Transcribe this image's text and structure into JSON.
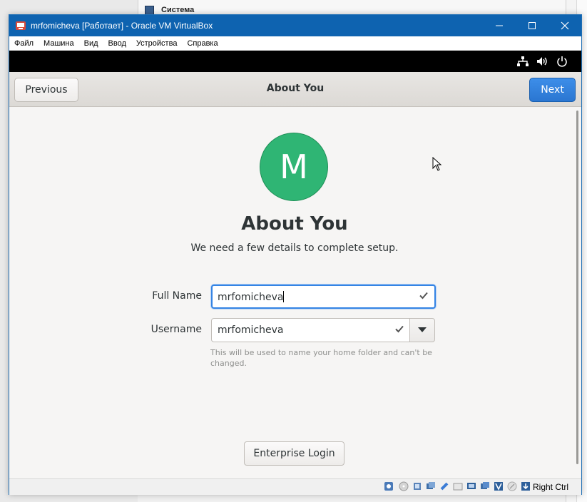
{
  "background": {
    "panel_title": "Система"
  },
  "window": {
    "title": "mrfomicheva [Работает] - Oracle VM VirtualBox",
    "menu": [
      "Файл",
      "Машина",
      "Вид",
      "Ввод",
      "Устройства",
      "Справка"
    ],
    "toolbar_icons": [
      "network-icon",
      "speaker-icon",
      "power-icon"
    ]
  },
  "header": {
    "previous_label": "Previous",
    "title": "About You",
    "next_label": "Next"
  },
  "content": {
    "avatar_letter": "M",
    "heading": "About You",
    "subtitle": "We need a few details to complete setup.",
    "full_name": {
      "label": "Full Name",
      "value": "mrfomicheva"
    },
    "username": {
      "label": "Username",
      "value": "mrfomicheva",
      "hint": "This will be used to name your home folder and can't be changed."
    },
    "enterprise_label": "Enterprise Login"
  },
  "statusbar": {
    "host_key": "Right Ctrl"
  },
  "colors": {
    "titlebar": "#0e63b0",
    "accent": "#3584e4",
    "avatar": "#2fb574"
  }
}
